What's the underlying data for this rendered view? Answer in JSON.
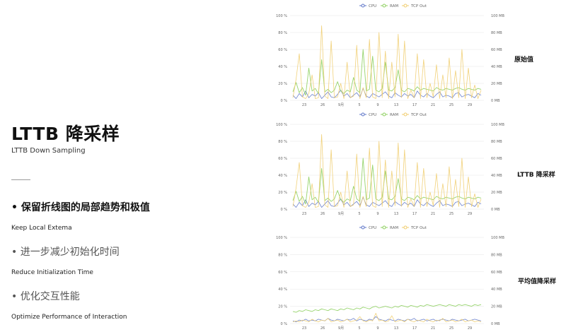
{
  "slide": {
    "title": "LTTB 降采样",
    "subtitle": "LTTB Down Sampling",
    "bullets": [
      {
        "zh": "• 保留折线图的局部趋势和极值",
        "en": "Keep Local Extema"
      },
      {
        "zh": "• 进一步减少初始化时间",
        "en": "Reduce Initialization Time"
      },
      {
        "zh": "• 优化交互性能",
        "en": "Optimize Performance of Interaction"
      }
    ]
  },
  "colors": {
    "cpu": "#5b73c7",
    "ram": "#8ccf5d",
    "tcp": "#f0cc6c",
    "grid": "#e6e6e6",
    "axis_text": "#666666"
  },
  "chart_data": [
    {
      "type": "line",
      "row_label": "原始值",
      "legend": [
        "CPU",
        "RAM",
        "TCP Out"
      ],
      "y_left_ticks": [
        "100 %",
        "80 %",
        "60 %",
        "40 %",
        "20 %",
        "0 %"
      ],
      "y_right_ticks": [
        "100 MB",
        "80 MB",
        "60 MB",
        "40 MB",
        "20 MB",
        "0 MB"
      ],
      "x_ticks": [
        "23",
        "26",
        "9月",
        "5",
        "9",
        "13",
        "17",
        "21",
        "25",
        "29"
      ],
      "ylim": [
        0,
        100
      ],
      "grid": true,
      "legend_position": "top-center",
      "series": [
        {
          "name": "CPU",
          "values": [
            6,
            2,
            8,
            4,
            11,
            3,
            7,
            5,
            9,
            2,
            6,
            10,
            4,
            3,
            7,
            12,
            5,
            8,
            3,
            6,
            9,
            4,
            14,
            5,
            3,
            8,
            6,
            4,
            7,
            10,
            5,
            3,
            9,
            6,
            4,
            8,
            5,
            7,
            3,
            11,
            6,
            4,
            8,
            5,
            3,
            7,
            10,
            4,
            6,
            5,
            3,
            8,
            9,
            4,
            6,
            7,
            5,
            3,
            8,
            6
          ]
        },
        {
          "name": "RAM",
          "values": [
            10,
            21,
            9,
            15,
            6,
            38,
            11,
            14,
            8,
            48,
            10,
            13,
            9,
            12,
            22,
            11,
            8,
            12,
            10,
            27,
            12,
            9,
            60,
            11,
            13,
            52,
            12,
            10,
            14,
            45,
            12,
            11,
            15,
            36,
            12,
            10,
            14,
            13,
            11,
            16,
            12,
            14,
            13,
            12,
            11,
            15,
            13,
            12,
            14,
            13,
            12,
            14,
            15,
            13,
            12,
            14,
            13,
            12,
            14,
            13
          ]
        },
        {
          "name": "TCP Out",
          "values": [
            3,
            25,
            55,
            4,
            2,
            8,
            30,
            2,
            3,
            88,
            5,
            2,
            70,
            3,
            4,
            20,
            2,
            45,
            3,
            5,
            65,
            2,
            15,
            3,
            72,
            4,
            2,
            80,
            3,
            58,
            2,
            45,
            4,
            78,
            3,
            70,
            2,
            12,
            3,
            55,
            2,
            48,
            3,
            20,
            4,
            42,
            2,
            30,
            3,
            50,
            2,
            35,
            3,
            60,
            2,
            38,
            3,
            18,
            2,
            12
          ]
        }
      ]
    },
    {
      "type": "line",
      "row_label": "LTTB 降采样",
      "legend": [
        "CPU",
        "RAM",
        "TCP Out"
      ],
      "y_left_ticks": [
        "100 %",
        "80 %",
        "60 %",
        "40 %",
        "20 %",
        "0 %"
      ],
      "y_right_ticks": [
        "100 MB",
        "80 MB",
        "60 MB",
        "40 MB",
        "20 MB",
        "0 MB"
      ],
      "x_ticks": [
        "23",
        "26",
        "9月",
        "5",
        "9",
        "13",
        "17",
        "21",
        "25",
        "29"
      ],
      "ylim": [
        0,
        100
      ],
      "grid": true,
      "legend_position": "top-center",
      "series": [
        {
          "name": "CPU",
          "values": [
            6,
            2,
            8,
            4,
            11,
            3,
            7,
            5,
            9,
            2,
            6,
            10,
            4,
            3,
            7,
            12,
            5,
            8,
            3,
            6,
            9,
            4,
            14,
            5,
            3,
            8,
            6,
            4,
            7,
            10,
            5,
            3,
            9,
            6,
            4,
            8,
            5,
            7,
            3,
            11,
            6,
            4,
            8,
            5,
            3,
            7,
            10,
            4,
            6,
            5,
            3,
            8,
            9,
            4,
            6,
            7,
            5,
            3,
            8,
            6
          ]
        },
        {
          "name": "RAM",
          "values": [
            10,
            21,
            9,
            15,
            6,
            38,
            11,
            14,
            8,
            48,
            10,
            13,
            9,
            12,
            22,
            11,
            8,
            12,
            10,
            27,
            12,
            9,
            60,
            11,
            13,
            52,
            12,
            10,
            14,
            45,
            12,
            11,
            15,
            36,
            12,
            10,
            14,
            13,
            11,
            16,
            12,
            14,
            13,
            12,
            11,
            15,
            13,
            12,
            14,
            13,
            12,
            14,
            15,
            13,
            12,
            14,
            13,
            12,
            14,
            13
          ]
        },
        {
          "name": "TCP Out",
          "values": [
            3,
            25,
            55,
            4,
            2,
            8,
            30,
            2,
            3,
            88,
            5,
            2,
            70,
            3,
            4,
            20,
            2,
            45,
            3,
            5,
            65,
            2,
            15,
            3,
            72,
            4,
            2,
            80,
            3,
            58,
            2,
            45,
            4,
            78,
            3,
            70,
            2,
            12,
            3,
            55,
            2,
            48,
            3,
            20,
            4,
            42,
            2,
            30,
            3,
            50,
            2,
            35,
            3,
            60,
            2,
            38,
            3,
            18,
            2,
            12
          ]
        }
      ]
    },
    {
      "type": "line",
      "row_label": "平均值降采样",
      "legend": [
        "CPU",
        "RAM",
        "TCP Out"
      ],
      "y_left_ticks": [
        "100 %",
        "80 %",
        "60 %",
        "40 %",
        "20 %",
        "0 %"
      ],
      "y_right_ticks": [
        "100 MB",
        "80 MB",
        "60 MB",
        "40 MB",
        "20 MB",
        "0 MB"
      ],
      "x_ticks": [
        "23",
        "26",
        "9月",
        "5",
        "9",
        "13",
        "17",
        "21",
        "25",
        "29"
      ],
      "ylim": [
        0,
        100
      ],
      "grid": true,
      "legend_position": "top-center",
      "series": [
        {
          "name": "CPU",
          "values": [
            3,
            2,
            4,
            3,
            5,
            3,
            4,
            3,
            5,
            4,
            3,
            6,
            4,
            3,
            5,
            4,
            3,
            5,
            4,
            6,
            3,
            5,
            4,
            3,
            5,
            4,
            8,
            5,
            4,
            3,
            5,
            4,
            3,
            5,
            4,
            3,
            5,
            4,
            6,
            3,
            4,
            5,
            3,
            4,
            5,
            3,
            4,
            5,
            4,
            3,
            5,
            4,
            3,
            4,
            5,
            3,
            4,
            5,
            4,
            3
          ]
        },
        {
          "name": "RAM",
          "values": [
            14,
            13,
            15,
            14,
            16,
            15,
            14,
            16,
            15,
            17,
            16,
            15,
            17,
            16,
            15,
            17,
            16,
            18,
            17,
            16,
            18,
            17,
            19,
            18,
            17,
            19,
            20,
            18,
            19,
            20,
            19,
            18,
            20,
            19,
            21,
            20,
            19,
            21,
            20,
            19,
            21,
            20,
            22,
            21,
            20,
            21,
            22,
            21,
            20,
            22,
            21,
            20,
            22,
            21,
            22,
            21,
            20,
            22,
            21,
            22
          ]
        },
        {
          "name": "TCP Out",
          "values": [
            2,
            3,
            2,
            4,
            3,
            2,
            5,
            3,
            2,
            4,
            3,
            6,
            2,
            3,
            4,
            2,
            3,
            5,
            2,
            3,
            4,
            8,
            3,
            2,
            4,
            3,
            12,
            3,
            4,
            2,
            3,
            9,
            2,
            3,
            4,
            2,
            5,
            3,
            2,
            4,
            3,
            2,
            5,
            3,
            2,
            4,
            3,
            6,
            2,
            3,
            4,
            2,
            3,
            5,
            2,
            3,
            4,
            2,
            3,
            2
          ]
        }
      ]
    }
  ]
}
